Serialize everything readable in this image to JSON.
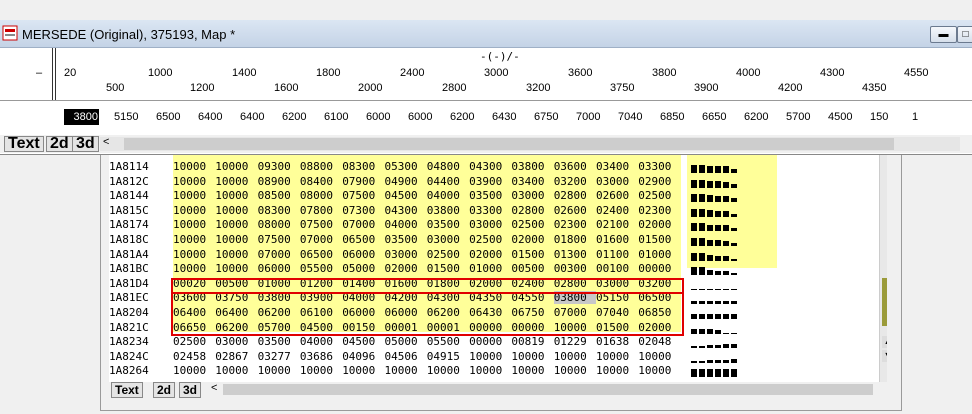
{
  "window": {
    "title": "MERSEDE (Original), 375193, Map *"
  },
  "header": {
    "title": "-(-)/-",
    "minus": "–",
    "row1": [
      "20",
      "1000",
      "1400",
      "1800",
      "2400",
      "3000",
      "3600",
      "3800",
      "4000",
      "4300",
      "4550"
    ],
    "row2": [
      "500",
      "1200",
      "1600",
      "2000",
      "2800",
      "3200",
      "3750",
      "3900",
      "4200",
      "4350"
    ]
  },
  "datarow": {
    "selected": "3800",
    "values": [
      "5150",
      "6500",
      "6400",
      "6400",
      "6200",
      "6100",
      "6000",
      "6000",
      "6200",
      "6430",
      "6750",
      "7000",
      "7040",
      "6850",
      "6650",
      "6200",
      "5700",
      "4500",
      "150",
      "1"
    ]
  },
  "tabs": {
    "text": "Text",
    "d2": "2d",
    "d3": "3d"
  },
  "hex": {
    "addresses": [
      "1A8114",
      "1A812C",
      "1A8144",
      "1A815C",
      "1A8174",
      "1A818C",
      "1A81A4",
      "1A81BC",
      "1A81D4",
      "1A81EC",
      "1A8204",
      "1A821C",
      "1A8234",
      "1A824C",
      "1A8264"
    ],
    "rows": [
      [
        "10000",
        "10000",
        "09300",
        "08800",
        "08300",
        "05300",
        "04800",
        "04300",
        "03800",
        "03600",
        "03400",
        "03300"
      ],
      [
        "10000",
        "10000",
        "08900",
        "08400",
        "07900",
        "04900",
        "04400",
        "03900",
        "03400",
        "03200",
        "03000",
        "02900"
      ],
      [
        "10000",
        "10000",
        "08500",
        "08000",
        "07500",
        "04500",
        "04000",
        "03500",
        "03000",
        "02800",
        "02600",
        "02500"
      ],
      [
        "10000",
        "10000",
        "08300",
        "07800",
        "07300",
        "04300",
        "03800",
        "03300",
        "02800",
        "02600",
        "02400",
        "02300"
      ],
      [
        "10000",
        "10000",
        "08000",
        "07500",
        "07000",
        "04000",
        "03500",
        "03000",
        "02500",
        "02300",
        "02100",
        "02000"
      ],
      [
        "10000",
        "10000",
        "07500",
        "07000",
        "06500",
        "03500",
        "03000",
        "02500",
        "02000",
        "01800",
        "01600",
        "01500"
      ],
      [
        "10000",
        "10000",
        "07000",
        "06500",
        "06000",
        "03000",
        "02500",
        "02000",
        "01500",
        "01300",
        "01100",
        "01000"
      ],
      [
        "10000",
        "10000",
        "06000",
        "05500",
        "05000",
        "02000",
        "01500",
        "01000",
        "00500",
        "00300",
        "00100",
        "00000"
      ],
      [
        "00020",
        "00500",
        "01000",
        "01200",
        "01400",
        "01600",
        "01800",
        "02000",
        "02400",
        "02800",
        "03000",
        "03200"
      ],
      [
        "03600",
        "03750",
        "03800",
        "03900",
        "04000",
        "04200",
        "04300",
        "04350",
        "04550",
        "03800",
        "05150",
        "06500"
      ],
      [
        "06400",
        "06400",
        "06200",
        "06100",
        "06000",
        "06000",
        "06200",
        "06430",
        "06750",
        "07000",
        "07040",
        "06850"
      ],
      [
        "06650",
        "06200",
        "05700",
        "04500",
        "00150",
        "00001",
        "00001",
        "00000",
        "00000",
        "10000",
        "01500",
        "02000"
      ],
      [
        "02500",
        "03000",
        "03500",
        "04000",
        "04500",
        "05000",
        "05500",
        "00000",
        "00819",
        "01229",
        "01638",
        "02048"
      ],
      [
        "02458",
        "02867",
        "03277",
        "03686",
        "04096",
        "04506",
        "04915",
        "10000",
        "10000",
        "10000",
        "10000",
        "10000"
      ],
      [
        "10000",
        "10000",
        "10000",
        "10000",
        "10000",
        "10000",
        "10000",
        "10000",
        "10000",
        "10000",
        "10000",
        "10000"
      ]
    ]
  },
  "colors": {
    "highlight_yellow": "#ffff99",
    "selection_red": "#e00000",
    "selected_bg": "#000000"
  }
}
